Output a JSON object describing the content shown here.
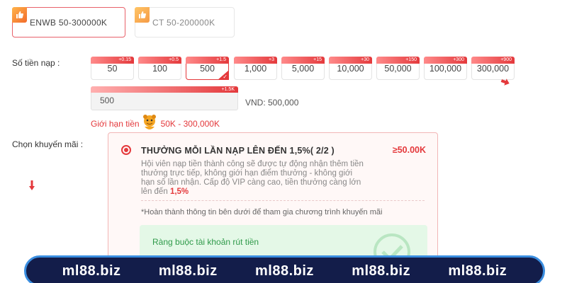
{
  "methods": [
    {
      "label": "ENWB  50-300000K"
    },
    {
      "label": "CT  50-200000K"
    }
  ],
  "amount_label": "Số tiền nạp :",
  "chips": [
    {
      "value": "50",
      "bonus": "+0.15"
    },
    {
      "value": "100",
      "bonus": "+0.5"
    },
    {
      "value": "500",
      "bonus": "+1.5"
    },
    {
      "value": "1,000",
      "bonus": "+3"
    },
    {
      "value": "5,000",
      "bonus": "+15"
    },
    {
      "value": "10,000",
      "bonus": "+30"
    },
    {
      "value": "50,000",
      "bonus": "+150"
    },
    {
      "value": "100,000",
      "bonus": "+300"
    },
    {
      "value": "300,000",
      "bonus": "+900"
    }
  ],
  "input": {
    "value": "500",
    "bonus": "+1.5K"
  },
  "vnd_text": "VND: 500,000",
  "limit": {
    "label": "Giới hạn tiền",
    "range": "50K  -  300,000K"
  },
  "promo_label": "Chọn khuyến mãi :",
  "promo": {
    "title": "THƯỞNG MỖI LẦN NẠP LÊN ĐẾN 1,5%( 2/2 )",
    "amount": "≥50.00K",
    "desc": "Hội viên nạp tiền thành công sẽ được tự động nhận thêm tiền thưởng trực tiếp, không giới hạn điểm thưởng - không giới hạn số lần nhận. Cấp độ VIP càng cao, tiền thưởng càng lớn lên đến ",
    "desc_highlight": "1,5%",
    "note": "*Hoàn thành thông tin bên dưới để tham gia chương trình khuyến mãi",
    "bind_label": "Ràng buộc tài khoản rút tiền"
  },
  "banner": [
    "ml88.biz",
    "ml88.biz",
    "ml88.biz",
    "ml88.biz",
    "ml88.biz"
  ],
  "colors": {
    "accent": "#e4393c",
    "banner_bg": "#131d4a",
    "banner_border": "#3a8ee0",
    "success": "#2f9a4a"
  }
}
